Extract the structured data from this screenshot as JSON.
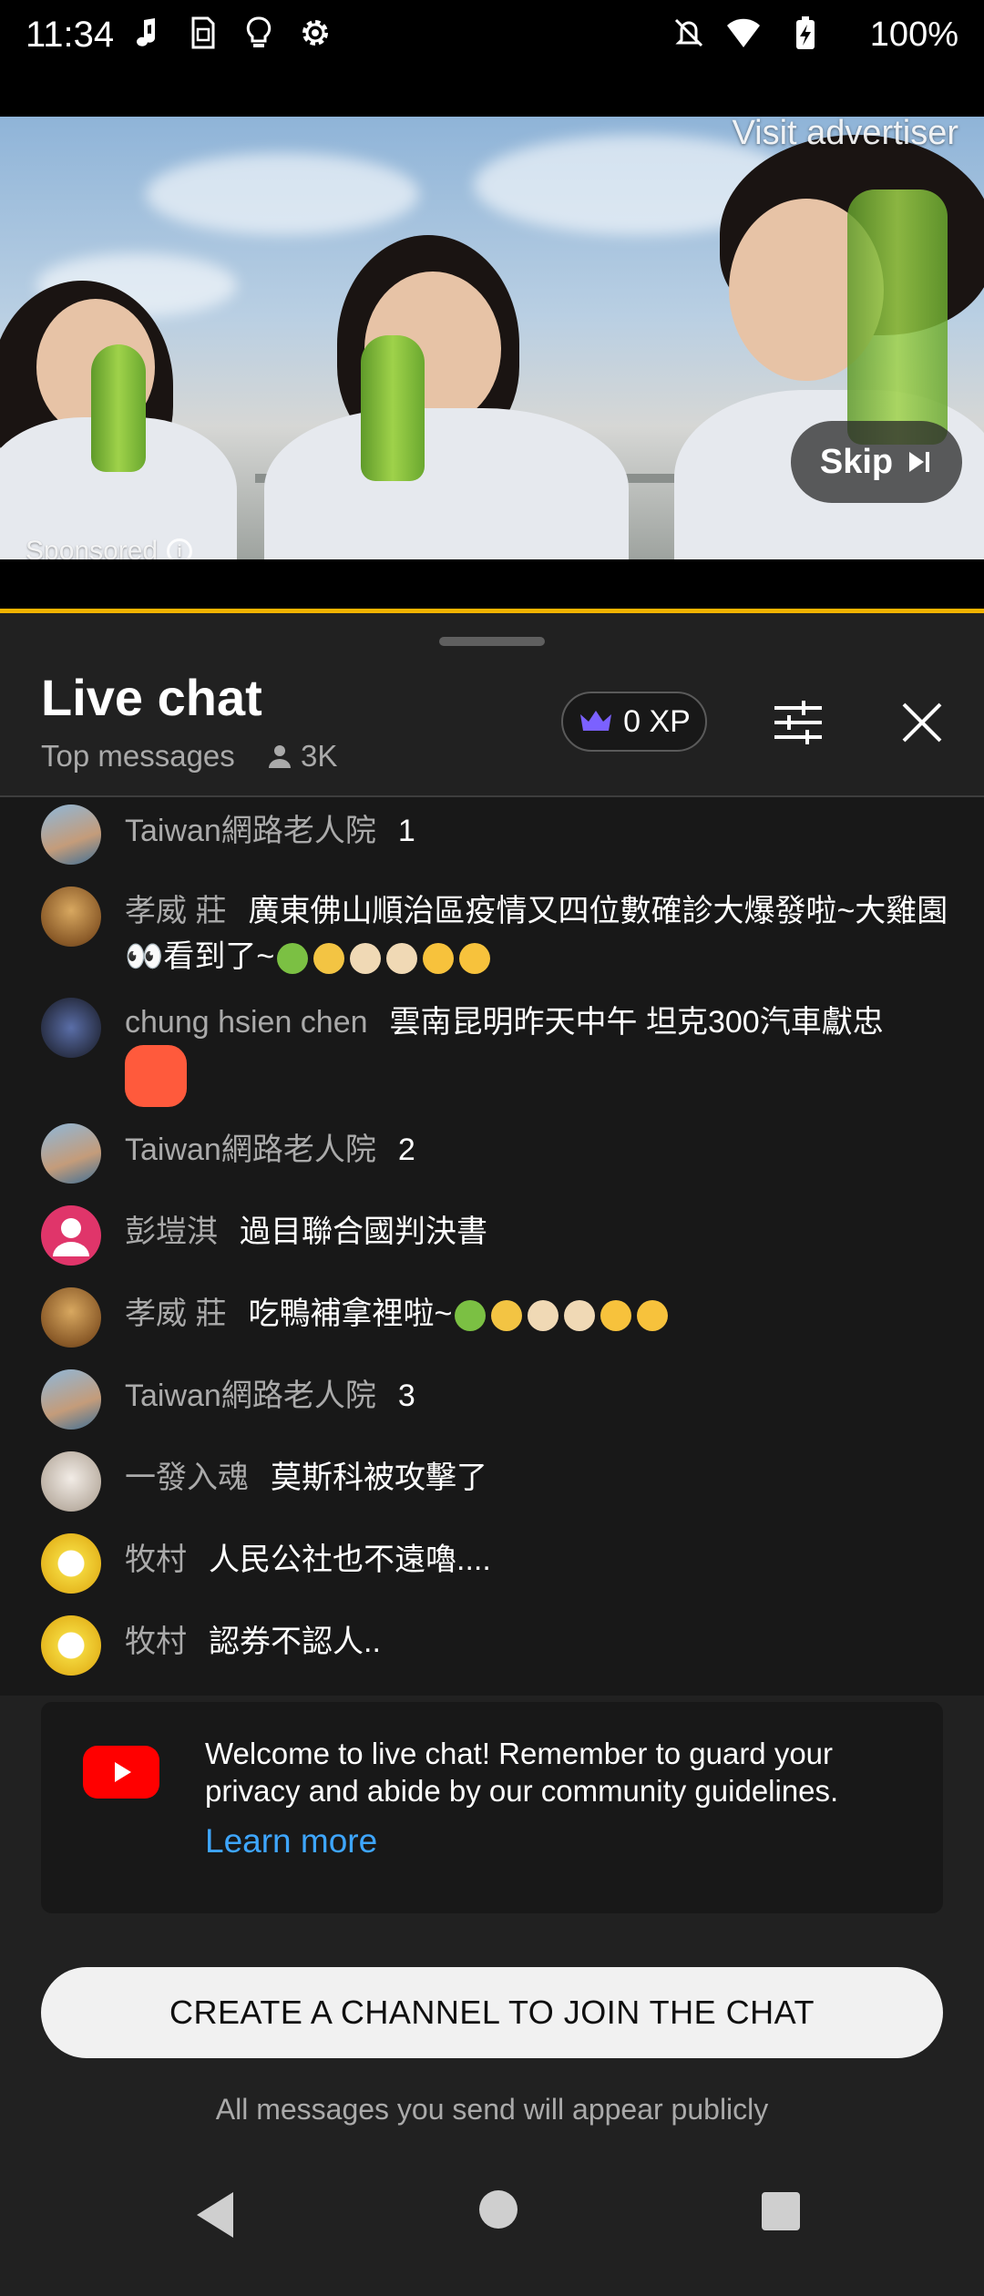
{
  "status_bar": {
    "time": "11:34",
    "left_icons": [
      "music-note-icon",
      "sim-card-icon",
      "lightbulb-icon",
      "settings-gear-icon"
    ],
    "right_icons": [
      "mute-bell-icon",
      "wifi-icon",
      "battery-charging-icon"
    ],
    "battery": "100%"
  },
  "ad": {
    "visit_label": "Visit advertiser",
    "skip_label": "Skip",
    "sponsored_label": "Sponsored",
    "progress_color": "#f2b300"
  },
  "chat": {
    "title": "Live chat",
    "filter_label": "Top messages",
    "viewers": "3K",
    "xp_label": "0 XP",
    "xp_icon_color": "#7b61ff",
    "messages": [
      {
        "author": "Taiwan網路老人院",
        "text": "1",
        "avatar_color": "#6b8fb0"
      },
      {
        "author": "孝威 莊",
        "text": "廣東佛山順治區疫情又四位數確診大爆發啦~大雞園👀看到了~",
        "avatar_color": "#c79a55"
      },
      {
        "author": "chung hsien chen",
        "text": "雲南昆明昨天中午 坦克300汽車獻忠",
        "avatar_color": "#3b4a6b"
      },
      {
        "author": "Taiwan網路老人院",
        "text": "2",
        "avatar_color": "#6b8fb0"
      },
      {
        "author": "彭塏淇",
        "text": "過目聯合國判決書",
        "avatar_color": "#e0356a"
      },
      {
        "author": "孝威 莊",
        "text": "吃鴨補拿裡啦~",
        "avatar_color": "#c79a55"
      },
      {
        "author": "Taiwan網路老人院",
        "text": "3",
        "avatar_color": "#6b8fb0"
      },
      {
        "author": "一發入魂",
        "text": "莫斯科被攻擊了",
        "avatar_color": "#d9d3cc"
      },
      {
        "author": "牧村",
        "text": "人民公社也不遠嚕....",
        "avatar_color": "#f2d43a"
      },
      {
        "author": "牧村",
        "text": "認券不認人..",
        "avatar_color": "#f2d43a"
      }
    ],
    "welcome_text": "Welcome to live chat! Remember to guard your privacy and abide by our community guidelines.",
    "learn_more": "Learn more",
    "create_channel_label": "CREATE A CHANNEL TO JOIN THE CHAT",
    "public_note": "All messages you send will appear publicly"
  },
  "nav": {
    "icons": [
      "back-triangle-icon",
      "home-circle-icon",
      "recents-square-icon"
    ]
  }
}
